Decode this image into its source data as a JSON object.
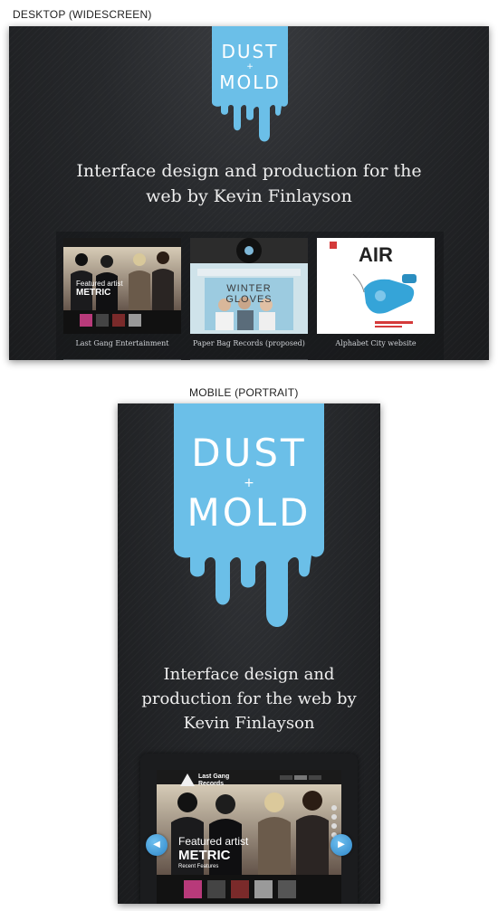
{
  "captions": {
    "desktop": "DESKTOP (WIDESCREEN)",
    "mobile": "MOBILE (PORTRAIT)"
  },
  "brand": {
    "line1": "DUST",
    "plus": "+",
    "line2": "MOLD",
    "color": "#6bbfe8"
  },
  "desktop": {
    "tagline": "Interface design and production for the web by Kevin Finlayson",
    "projects": [
      {
        "label": "Last Gang Entertainment",
        "thumb_text_1": "Featured artist",
        "thumb_text_2": "METRIC"
      },
      {
        "label": "Paper Bag Records (proposed)",
        "thumb_text_1": "WINTER GLOVES"
      },
      {
        "label": "Alphabet City website",
        "thumb_text_1": "AIR"
      }
    ]
  },
  "mobile": {
    "tagline": "Interface design and production for the web by Kevin Finlayson",
    "preview": {
      "text_1": "Featured artist",
      "text_2": "METRIC",
      "text_3": "Recent Features",
      "logo_text": "Last Gang Records"
    },
    "prev_glyph": "◀",
    "next_glyph": "▶"
  },
  "colors": {
    "background": "#26282b",
    "accent_blue": "#6bbfe8",
    "arrow_blue": "#2e86c8"
  }
}
